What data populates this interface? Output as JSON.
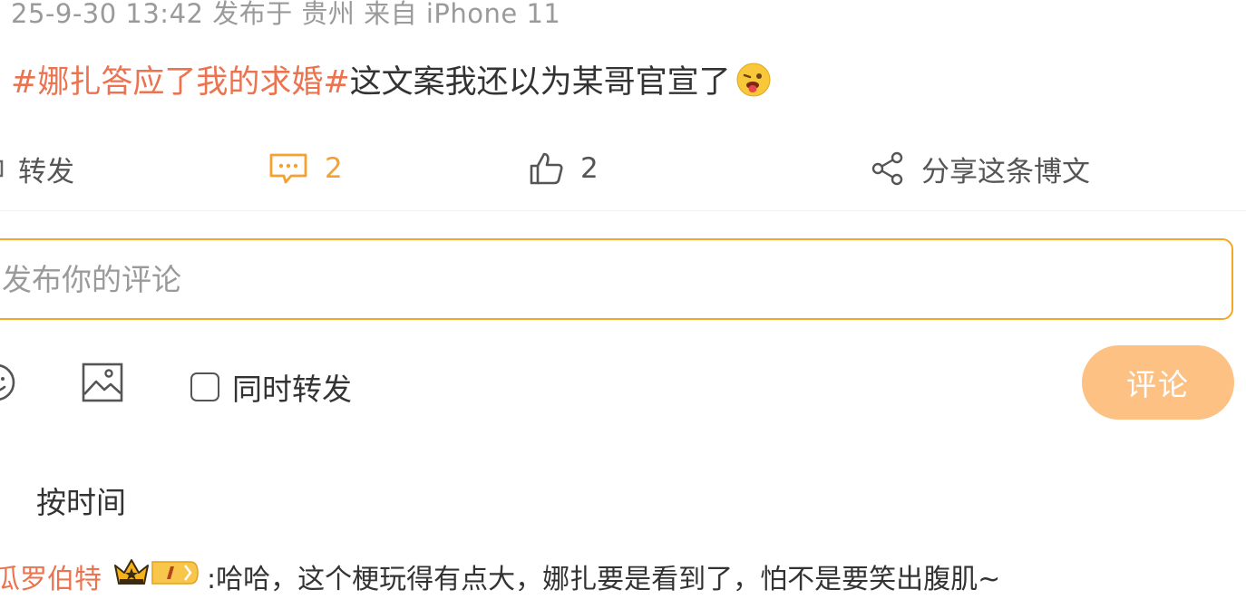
{
  "post": {
    "meta": "25-9-30 13:42  发布于 贵州  来自 iPhone 11",
    "hashtag": "#娜扎答应了我的求婚#",
    "text": "这文案我还以为某哥官宣了",
    "emoji_icon": "tongue-out-emoji"
  },
  "actions": {
    "repost_label": "转发",
    "comment_count": "2",
    "like_count": "2",
    "share_label": "分享这条博文"
  },
  "composer": {
    "placeholder": "发布你的评论",
    "value": "",
    "also_repost_label": "同时转发",
    "also_repost_checked": false,
    "submit_label": "评论"
  },
  "comments": {
    "sort_label": "按时间",
    "items": [
      {
        "username": "瓜罗伯特",
        "text": ":哈哈，这个梗玩得有点大，娜扎要是看到了，怕不是要笑出腹肌~"
      }
    ]
  },
  "colors": {
    "accent": "#f5a623",
    "hashtag": "#eb7350",
    "comment_active": "#f7a032",
    "submit_disabled": "#fdc184",
    "meta": "#9a9a9a"
  }
}
